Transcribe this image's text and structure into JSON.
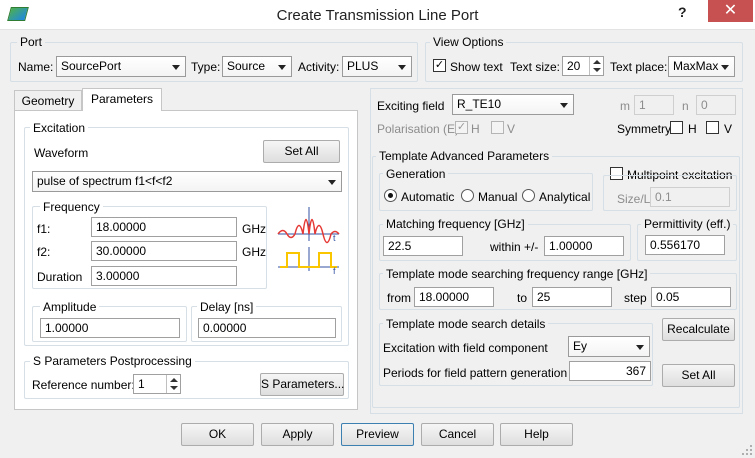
{
  "window": {
    "title": "Create Transmission Line Port",
    "help": "?",
    "close": "✕"
  },
  "port": {
    "group_label": "Port",
    "name_label": "Name:",
    "name_value": "SourcePort",
    "type_label": "Type:",
    "type_value": "Source",
    "activity_label": "Activity:",
    "activity_value": "PLUS"
  },
  "view_options": {
    "group_label": "View Options",
    "show_text_label": "Show text",
    "show_text_checked": true,
    "text_size_label": "Text size:",
    "text_size_value": "20",
    "text_place_label": "Text place:",
    "text_place_value": "MaxMax"
  },
  "tabs": [
    "Geometry",
    "Parameters"
  ],
  "excitation": {
    "group_label": "Excitation",
    "waveform_label": "Waveform",
    "set_all_label": "Set All",
    "waveform_value": "pulse of spectrum f1<f<f2",
    "frequency_label": "Frequency",
    "f1_label": "f1:",
    "f1_value": "18.00000",
    "f1_unit": "GHz",
    "f2_label": "f2:",
    "f2_value": "30.00000",
    "f2_unit": "GHz",
    "duration_label": "Duration",
    "duration_value": "3.00000",
    "amplitude_label": "Amplitude",
    "amplitude_value": "1.00000",
    "delay_label": "Delay [ns]",
    "delay_value": "0.00000"
  },
  "s_params": {
    "group_label": "S Parameters Postprocessing",
    "ref_label": "Reference number:",
    "ref_value": "1",
    "button_label": "S Parameters..."
  },
  "exciting": {
    "field_label": "Exciting field",
    "field_value": "R_TE10",
    "m_label": "m",
    "m_value": "1",
    "n_label": "n",
    "n_value": "0",
    "polarisation_label": "Polarisation (E)",
    "pol_h_label": "H",
    "pol_h_checked": true,
    "pol_v_label": "V",
    "pol_v_checked": false,
    "symmetry_label": "Symmetry",
    "sym_h_label": "H",
    "sym_v_label": "V"
  },
  "template": {
    "group_label": "Template Advanced Parameters",
    "generation_label": "Generation",
    "gen_options": [
      "Automatic",
      "Manual",
      "Analytical"
    ],
    "gen_selected": "Automatic",
    "multipoint_label": "Multipoint excitation",
    "size_l_label": "Size/L",
    "size_l_value": "0.1",
    "matching_label": "Matching frequency [GHz]",
    "matching_value": "22.5",
    "within_label": "within +/-",
    "within_value": "1.00000",
    "permittivity_label": "Permittivity (eff.)",
    "permittivity_value": "0.556170",
    "range_label": "Template mode searching frequency range [GHz]",
    "from_label": "from",
    "from_value": "18.00000",
    "to_label": "to",
    "to_value": "25",
    "step_label": "step",
    "step_value": "0.05",
    "details_label": "Template mode search details",
    "component_label": "Excitation with field component",
    "component_value": "Ey",
    "periods_label": "Periods for field pattern generation",
    "periods_value": "367",
    "recalculate_label": "Recalculate",
    "set_all_label": "Set All"
  },
  "footer": {
    "ok": "OK",
    "apply": "Apply",
    "preview": "Preview",
    "cancel": "Cancel",
    "help": "Help"
  },
  "colors": {
    "title_close": "#c75050",
    "group_border": "#d5dfe5",
    "wave_red": "#e53935",
    "wave_yellow": "#f9c600",
    "wave_blue": "#3050a0"
  }
}
